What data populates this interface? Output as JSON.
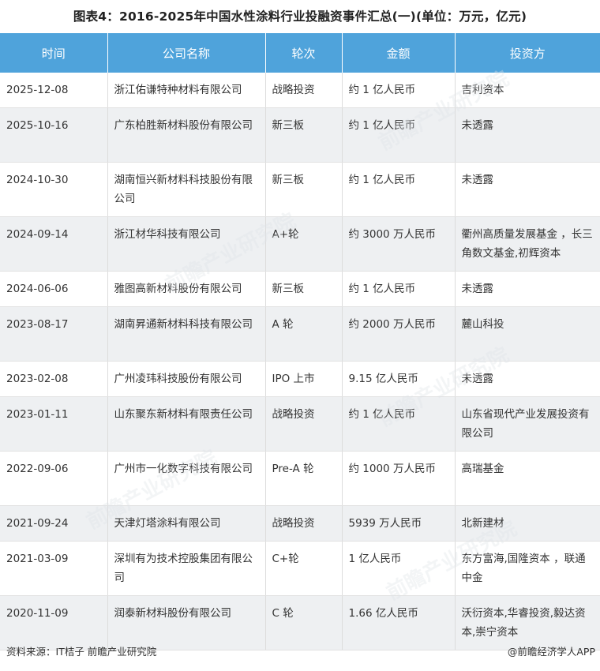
{
  "title": "图表4：2016-2025年中国水性涂料行业投融资事件汇总(一)(单位：万元，亿元)",
  "table": {
    "headers": [
      "时间",
      "公司名称",
      "轮次",
      "金额",
      "投资方"
    ],
    "rows": [
      [
        "2025-12-08",
        "浙江佑谦特种材料有限公司",
        "战略投资",
        "约 1 亿人民币",
        "吉利资本"
      ],
      [
        "2025-10-16",
        "广东柏胜新材料股份有限公司",
        "新三板",
        "约 1 亿人民币",
        "未透露"
      ],
      [
        "2024-10-30",
        "湖南恒兴新材料科技股份有限公司",
        "新三板",
        "约 1 亿人民币",
        "未透露"
      ],
      [
        "2024-09-14",
        "浙江材华科技有限公司",
        "A+轮",
        "约 3000 万人民币",
        "衢州高质量发展基金 ，长三角数文基金,初辉资本"
      ],
      [
        "2024-06-06",
        "雅图高新材料股份有限公司",
        "新三板",
        "约 1 亿人民币",
        "未透露"
      ],
      [
        "2023-08-17",
        "湖南昇通新材料科技有限公司",
        "A 轮",
        "约 2000 万人民币",
        "麓山科投"
      ],
      [
        "2023-02-08",
        "广州凌玮科技股份有限公司",
        "IPO 上市",
        "9.15 亿人民币",
        "未透露"
      ],
      [
        "2023-01-11",
        "山东聚东新材料有限责任公司",
        "战略投资",
        "约 1 亿人民币",
        "山东省现代产业发展投资有限公司"
      ],
      [
        "2022-09-06",
        "广州市一化数字科技有限公司",
        "Pre-A 轮",
        "约 1000 万人民币",
        "高瑞基金"
      ],
      [
        "2021-09-24",
        "天津灯塔涂料有限公司",
        "战略投资",
        "5939 万人民币",
        "北新建材"
      ],
      [
        "2021-03-09",
        "深圳有为技术控股集团有限公司",
        "C+轮",
        "1 亿人民币",
        "东方富海,国隆资本 ，联通中金"
      ],
      [
        "2020-11-09",
        "润泰新材料股份有限公司",
        "C 轮",
        "1.66 亿人民币",
        "沃衍资本,华睿投资,毅达资本,崇宁资本"
      ]
    ]
  },
  "footer": {
    "source": "资料来源：IT桔子 前瞻产业研究院",
    "brand": "@前瞻经济学人APP"
  },
  "watermark": "前瞻产业研究院"
}
